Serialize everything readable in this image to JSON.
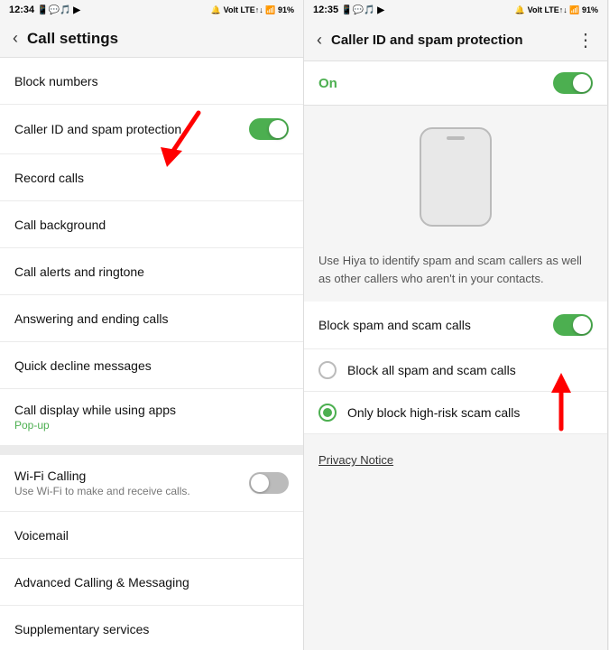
{
  "left_panel": {
    "status": {
      "time": "12:34",
      "icons_left": "📱 💬 🎵",
      "icons_right": "🔔 Volt LTE↑↓ 91%"
    },
    "header": {
      "back_icon": "‹",
      "title": "Call settings"
    },
    "items": [
      {
        "id": "block-numbers",
        "label": "Block numbers",
        "has_toggle": false,
        "sub": ""
      },
      {
        "id": "caller-id",
        "label": "Caller ID and spam protection",
        "has_toggle": true,
        "toggle_on": true,
        "sub": ""
      },
      {
        "id": "record-calls",
        "label": "Record calls",
        "has_toggle": false,
        "sub": ""
      },
      {
        "id": "call-background",
        "label": "Call background",
        "has_toggle": false,
        "sub": ""
      },
      {
        "id": "call-alerts",
        "label": "Call alerts and ringtone",
        "has_toggle": false,
        "sub": ""
      },
      {
        "id": "answering-ending",
        "label": "Answering and ending calls",
        "has_toggle": false,
        "sub": ""
      },
      {
        "id": "quick-decline",
        "label": "Quick decline messages",
        "has_toggle": false,
        "sub": ""
      },
      {
        "id": "call-display",
        "label": "Call display while using apps",
        "has_toggle": false,
        "sub": "Pop-up",
        "sub_color": "green"
      },
      {
        "id": "divider",
        "type": "divider"
      },
      {
        "id": "wifi-calling",
        "label": "Wi-Fi Calling",
        "has_toggle": true,
        "toggle_on": false,
        "sub": "Use Wi-Fi to make and receive calls.",
        "sub_color": "gray"
      },
      {
        "id": "voicemail",
        "label": "Voicemail",
        "has_toggle": false,
        "sub": ""
      },
      {
        "id": "advanced-calling",
        "label": "Advanced Calling & Messaging",
        "has_toggle": false,
        "sub": ""
      },
      {
        "id": "supplementary",
        "label": "Supplementary services",
        "has_toggle": false,
        "sub": ""
      }
    ]
  },
  "right_panel": {
    "status": {
      "time": "12:35",
      "icons_right": "🔔 Volt LTE↑↓ 91%"
    },
    "header": {
      "back_icon": "‹",
      "title": "Caller ID and spam protection",
      "menu_icon": "⋮"
    },
    "on_label": "On",
    "description": "Use Hiya to identify spam and scam callers as well as other callers who aren't in your contacts.",
    "block_spam_label": "Block spam and scam calls",
    "block_spam_toggle_on": true,
    "radio_options": [
      {
        "id": "block-all",
        "label": "Block all spam and scam calls",
        "selected": false
      },
      {
        "id": "block-high-risk",
        "label": "Only block high-risk scam calls",
        "selected": true
      }
    ],
    "privacy_link": "Privacy Notice"
  }
}
